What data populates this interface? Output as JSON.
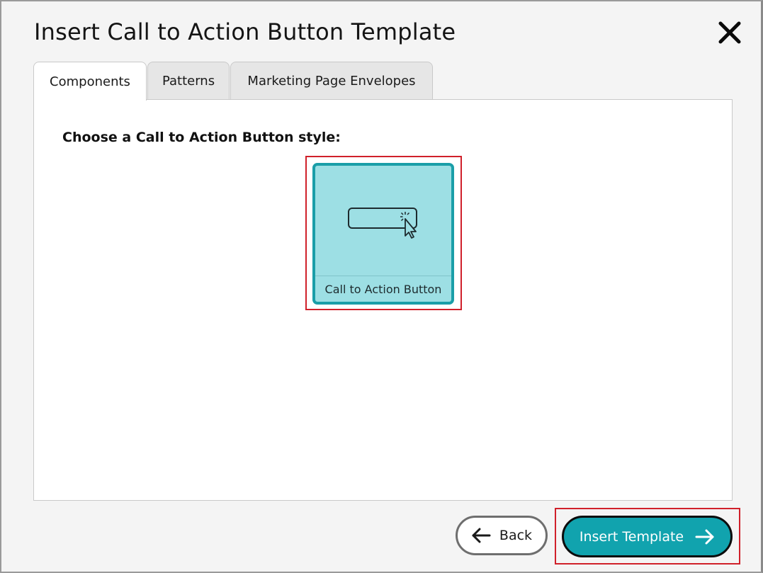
{
  "dialog": {
    "title": "Insert Call to Action Button Template",
    "close_icon": "close-icon"
  },
  "tabs": [
    {
      "label": "Components",
      "active": true
    },
    {
      "label": "Patterns",
      "active": false
    },
    {
      "label": "Marketing Page Envelopes",
      "active": false
    }
  ],
  "content": {
    "prompt": "Choose a Call to Action Button style:",
    "cards": [
      {
        "label": "Call to Action Button",
        "icon": "cta-button-cursor-icon",
        "selected": true
      }
    ]
  },
  "footer": {
    "back_label": "Back",
    "insert_label": "Insert Template"
  },
  "colors": {
    "accent": "#11a3ae",
    "card_bg": "#9ddfe4",
    "highlight": "#d0202a"
  }
}
